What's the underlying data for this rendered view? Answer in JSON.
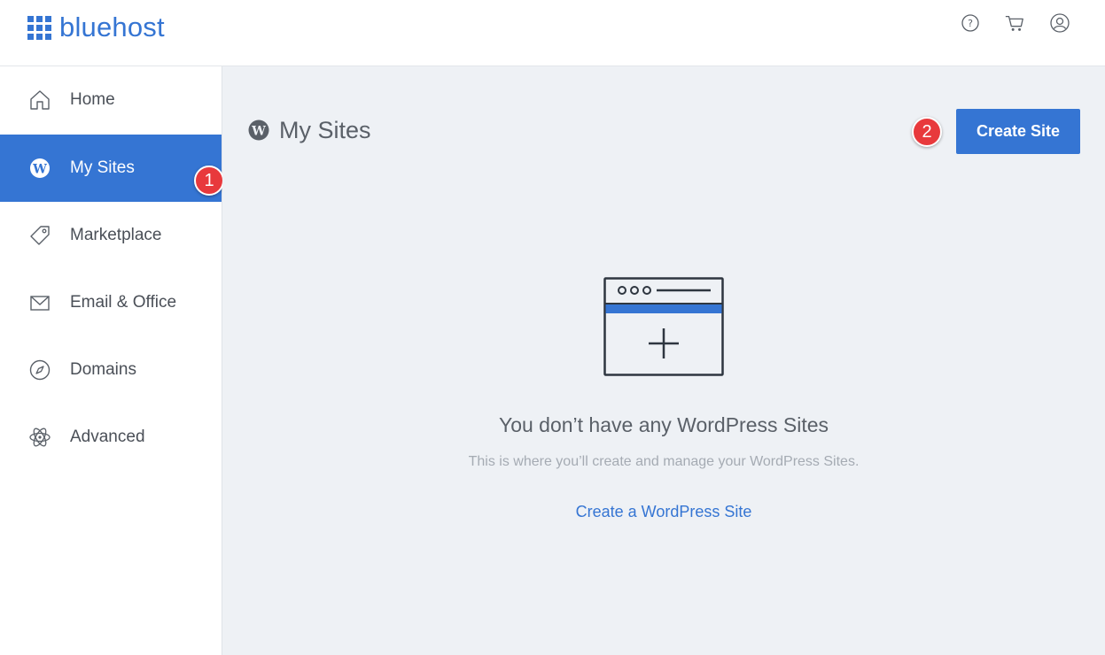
{
  "brand": {
    "name": "bluehost",
    "color": "#3575d3"
  },
  "topbar": {
    "icons": [
      "help-icon",
      "cart-icon",
      "account-icon"
    ]
  },
  "sidebar": {
    "items": [
      {
        "label": "Home",
        "icon": "home-icon"
      },
      {
        "label": "My Sites",
        "icon": "wordpress-icon",
        "active": true
      },
      {
        "label": "Marketplace",
        "icon": "tag-icon"
      },
      {
        "label": "Email & Office",
        "icon": "envelope-icon"
      },
      {
        "label": "Domains",
        "icon": "compass-icon"
      },
      {
        "label": "Advanced",
        "icon": "atom-icon"
      }
    ]
  },
  "annotations": {
    "badge_1": "1",
    "badge_2": "2",
    "badge_color": "#e8393c"
  },
  "main": {
    "title": "My Sites",
    "create_button": "Create Site",
    "empty_state": {
      "title": "You don’t have any WordPress Sites",
      "subtitle": "This is where you’ll create and manage your WordPress Sites.",
      "link": "Create a WordPress Site"
    }
  }
}
